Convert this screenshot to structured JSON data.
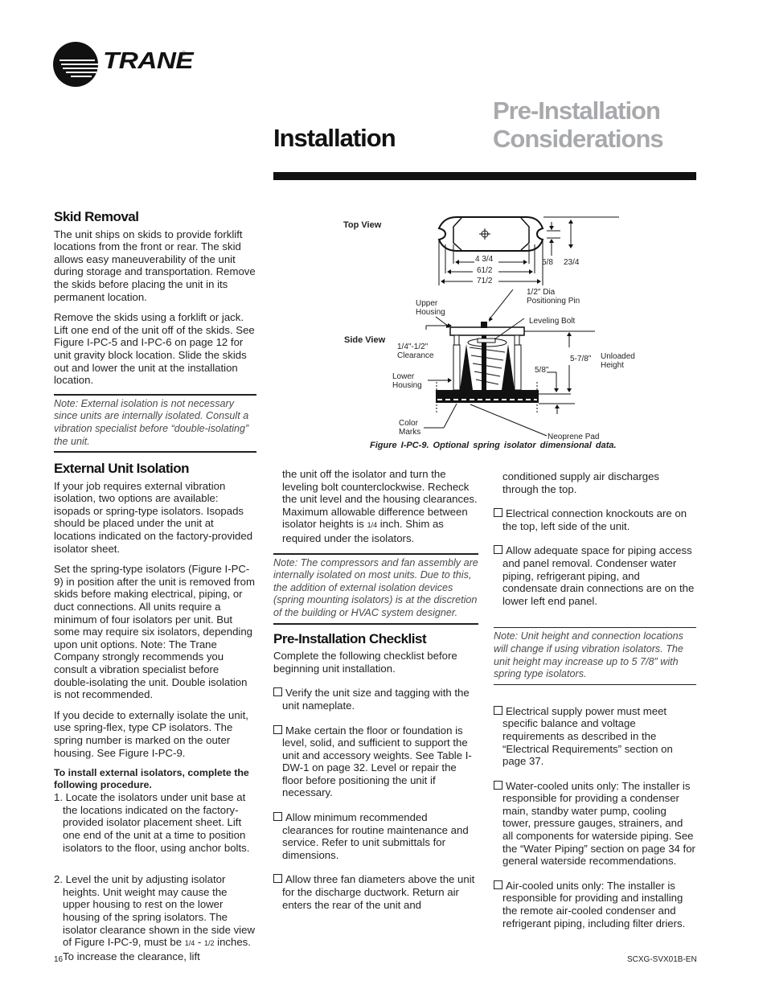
{
  "header": {
    "brand": "TRANE",
    "registered": "®",
    "section_title": "Installation",
    "subtitle_line1": "Pre-Installation",
    "subtitle_line2": "Considerations"
  },
  "figure": {
    "top_view_label": "Top View",
    "side_view_label": "Side View",
    "dims": {
      "d1": "4 3/4",
      "d2": "61/2",
      "d3": "71/2",
      "d4": "5/8",
      "d5": "23/4",
      "pin": "1/2\" Dia",
      "pin2": "Positioning Pin",
      "upper1": "Upper",
      "upper2": "Housing",
      "leveling": "Leveling Bolt",
      "clear1": "1/4\"-1/2\"",
      "clear2": "Clearance",
      "height": "5-7/8\"",
      "unloaded1": "Unloaded",
      "unloaded2": "Height",
      "pad_h": "5/8\"",
      "lower1": "Lower",
      "lower2": "Housing",
      "color1": "Color",
      "color2": "Marks",
      "neoprene": "Neoprene Pad"
    },
    "caption": "Figure I-PC-9. Optional spring isolator dimensional data."
  },
  "skid": {
    "heading": "Skid Removal",
    "p1": "The unit ships on skids to provide forklift locations from the front or rear. The skid allows easy maneuverability of the unit during storage and transportation. Remove the skids before placing the unit in its permanent location.",
    "p2": "Remove the skids using a forklift or jack. Lift one end of the unit off of the skids. See Figure I-PC-5 and I-PC-6 on page 12 for unit gravity block location. Slide the skids out and lower the unit at the installation location.",
    "note": "Note: External isolation is not necessary since units are internally isolated. Consult a vibration specialist before “double-isolating” the unit."
  },
  "isolation": {
    "heading": "External Unit Isolation",
    "p1": "If your job requires external vibration isolation, two options are available: isopads or spring-type isolators. Isopads should be placed under the unit at locations indicated on the factory-provided isolator sheet.",
    "p2": "Set the spring-type isolators (Figure I-PC-9) in position after the unit is removed from skids before making electrical, piping, or duct connections. All units require a minimum of four isolators per unit. But some may require six isolators, depending upon unit options. Note: The Trane Company strongly recommends you consult a vibration specialist before double-isolating the unit. Double isolation is not recommended.",
    "p3": "If you decide to externally isolate the unit, use spring-flex, type CP isolators. The spring number is marked on the outer housing.  See Figure I-PC-9.",
    "procedure_heading": "To install external isolators, complete the following procedure.",
    "step1": "1. Locate the isolators under unit base at the  locations indicated on the factory-provided isolator placement sheet. Lift one end of the unit at a time to position isolators to the floor, using anchor bolts.",
    "step2a": "2. Level the unit by adjusting isolator heights.  Unit weight may cause the upper housing to rest on the lower housing of the spring isolators. The isolator clearance shown in the side view of Figure I-PC-9, must be ",
    "step2_frac1": "1/4",
    "step2_dash": " - ",
    "step2_frac2": "1/2",
    "step2b": " inches. To increase the clearance, lift",
    "step2c": "the unit off the isolator and turn the leveling bolt counterclockwise.  Recheck the unit level and the housing clearances. Maximum allowable difference between isolator heights is ",
    "step2_frac3": "1/4",
    "step2d": " inch. Shim as required under the isolators.",
    "note": "Note: The compressors and fan assembly are internally isolated on most units. Due to this, the addition of external isolation devices (spring mounting isolators) is at the discretion of the building or HVAC system  designer."
  },
  "checklist": {
    "heading": "Pre-Installation Checklist",
    "intro": "Complete the following checklist before beginning unit installation.",
    "items": [
      "Verify the unit size and tagging with the unit nameplate.",
      "Make certain the floor or foundation is level, solid, and sufficient to support the unit and accessory weights. See Table I-DW-1 on page 32. Level or repair the floor before positioning the unit if necessary.",
      "Allow minimum recommended clearances for routine maintenance and service. Refer to unit submittals for dimensions.",
      "Allow three fan diameters above the unit for the discharge ductwork. Return air enters the rear of the unit and",
      "Electrical connection knockouts are on the top, left side of the unit.",
      "Allow adequate space for piping access and panel removal. Condenser water piping, refrigerant piping, and condensate drain connections are on the lower left end panel.",
      "Electrical supply power must meet specific balance and voltage requirements as described in the “Electrical Requirements” section on page 37.",
      "Water-cooled units only: The installer is responsible for providing a condenser main, standby water pump, cooling tower, pressure gauges, strainers, and all components for waterside piping. See the “Water Piping” section on page 34 for general waterside recommendations.",
      "Air-cooled units only: The installer is responsible for providing and installing the remote air-cooled condenser and refrigerant piping, including filter driers."
    ],
    "item4_continuation": "conditioned supply air discharges through the top.",
    "note": "Note: Unit height and connection locations will change if using vibration isolators. The unit height may increase up to  5 7/8” with spring type isolators."
  },
  "footer": {
    "page_number": "16",
    "doc_code": "SCXG-SVX01B-EN"
  }
}
